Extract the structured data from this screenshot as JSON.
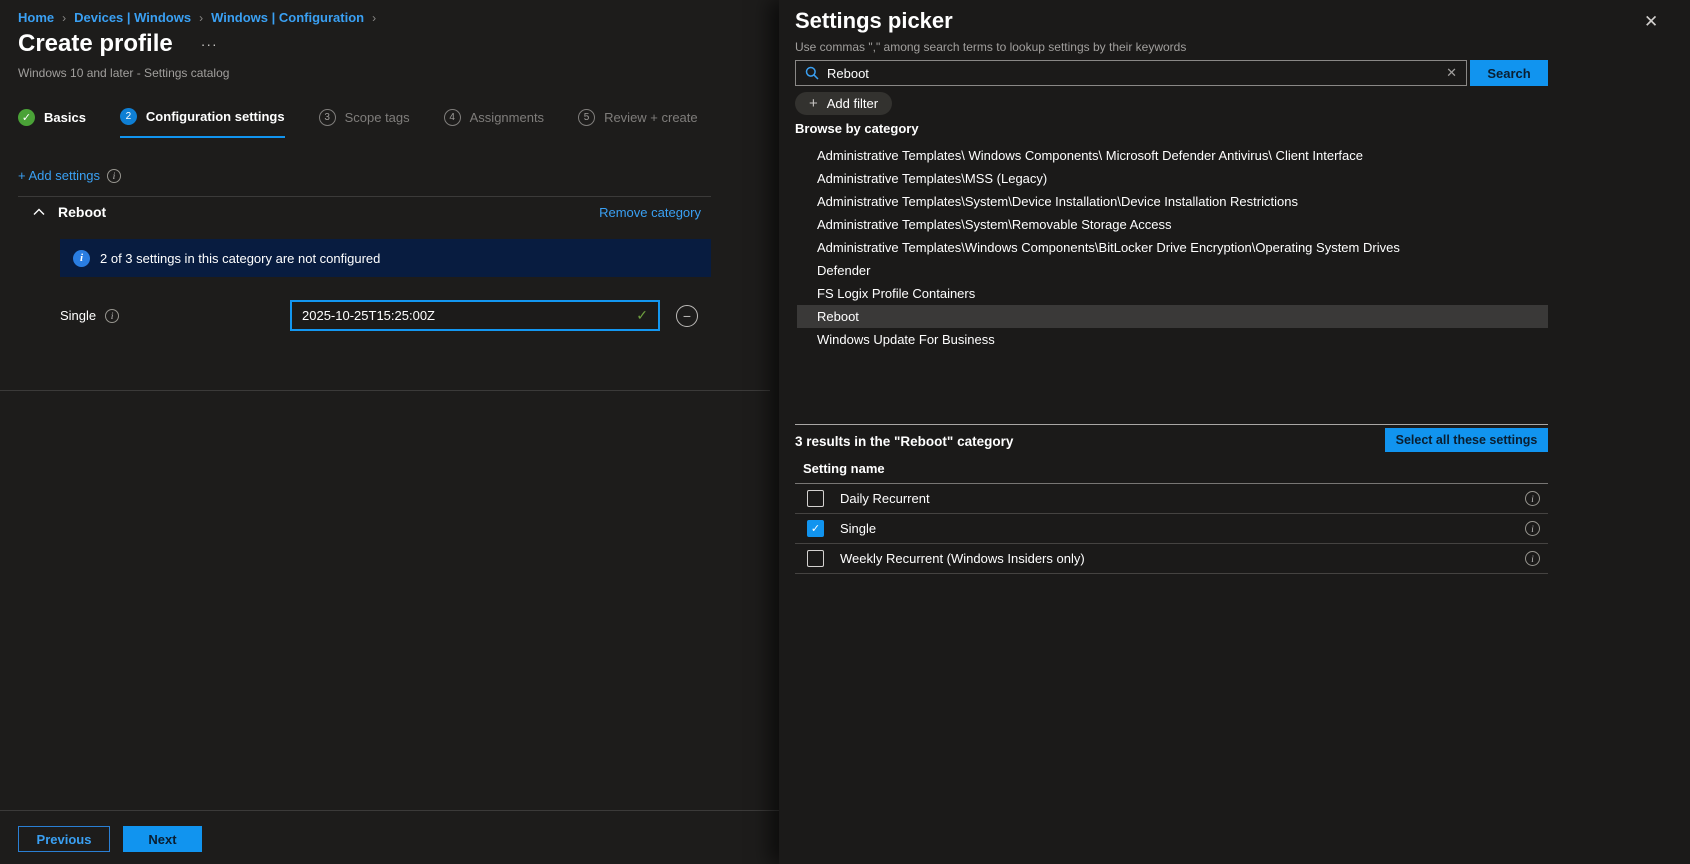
{
  "icons": {
    "check": "✓",
    "ellipsis": "···",
    "breadcrumb_separator": "›",
    "info": "i",
    "minus": "−",
    "close": "✕",
    "clear": "✕",
    "plus": "+"
  },
  "colors": {
    "accent_blue": "#1194ef",
    "link_blue": "#3aa0f3",
    "success_green": "#4aa237",
    "banner_background": "#081c40"
  },
  "left": {
    "breadcrumb": [
      {
        "label": "Home"
      },
      {
        "label": "Devices | Windows"
      },
      {
        "label": "Windows | Configuration"
      }
    ],
    "title": "Create profile",
    "subtitle": "Windows 10 and later - Settings catalog",
    "steps": [
      {
        "label": "Basics"
      },
      {
        "number": "2",
        "label": "Configuration settings"
      },
      {
        "number": "3",
        "label": "Scope tags"
      },
      {
        "number": "4",
        "label": "Assignments"
      },
      {
        "number": "5",
        "label": "Review + create"
      }
    ],
    "add_settings_label": "+ Add settings",
    "category": {
      "name": "Reboot",
      "remove_label": "Remove category",
      "banner_text": "2 of 3 settings in this category are not configured",
      "setting_label": "Single",
      "setting_value": "2025-10-25T15:25:00Z"
    },
    "footer": {
      "previous_label": "Previous",
      "next_label": "Next"
    }
  },
  "panel": {
    "title": "Settings picker",
    "subtitle": "Use commas \",\" among search terms to lookup settings by their keywords",
    "search": {
      "value": "Reboot",
      "button_label": "Search"
    },
    "add_filter_label": "Add filter",
    "browse_heading": "Browse by category",
    "categories": [
      {
        "label": "Administrative Templates\\ Windows Components\\ Microsoft Defender Antivirus\\ Client Interface"
      },
      {
        "label": "Administrative Templates\\MSS (Legacy)"
      },
      {
        "label": "Administrative Templates\\System\\Device Installation\\Device Installation Restrictions"
      },
      {
        "label": "Administrative Templates\\System\\Removable Storage Access"
      },
      {
        "label": "Administrative Templates\\Windows Components\\BitLocker Drive Encryption\\Operating System Drives"
      },
      {
        "label": "Defender"
      },
      {
        "label": "FS Logix Profile Containers"
      },
      {
        "label": "Reboot",
        "selected": true
      },
      {
        "label": "Windows Update For Business"
      }
    ],
    "results": {
      "summary": "3 results in the \"Reboot\" category",
      "select_all_label": "Select all these settings",
      "column_header": "Setting name",
      "rows": [
        {
          "label": "Daily Recurrent",
          "checked": false
        },
        {
          "label": "Single",
          "checked": true
        },
        {
          "label": "Weekly Recurrent (Windows Insiders only)",
          "checked": false
        }
      ]
    }
  }
}
